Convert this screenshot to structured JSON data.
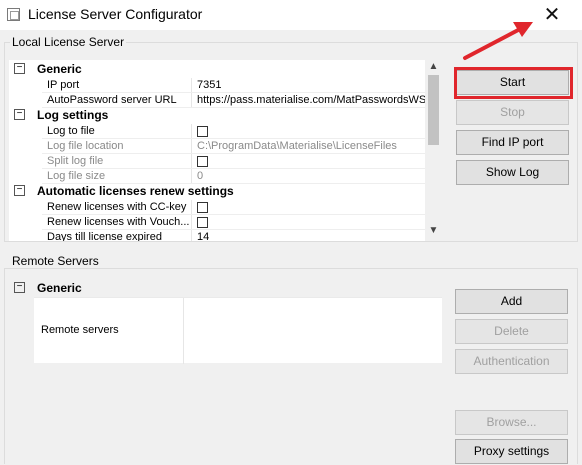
{
  "window": {
    "title": "License Server Configurator",
    "close_glyph": "✕",
    "app_icon": "window-icon"
  },
  "local_group": {
    "title": "Local License Server",
    "categories": [
      {
        "label": "Generic",
        "toggle": "−",
        "rows": [
          {
            "label": "IP port",
            "value": "7351",
            "type": "text",
            "dim": false
          },
          {
            "label": "AutoPassword server URL",
            "value": "https://pass.materialise.com/MatPasswordsWS/M",
            "type": "text",
            "dim": false
          }
        ]
      },
      {
        "label": "Log settings",
        "toggle": "−",
        "rows": [
          {
            "label": "Log to file",
            "value": "",
            "type": "checkbox",
            "dim": false
          },
          {
            "label": "Log file location",
            "value": "C:\\ProgramData\\Materialise\\LicenseFiles",
            "type": "text",
            "dim": true
          },
          {
            "label": "Split log file",
            "value": "",
            "type": "checkbox",
            "dim": true
          },
          {
            "label": "Log file size",
            "value": "0",
            "type": "text",
            "dim": true
          }
        ]
      },
      {
        "label": "Automatic licenses renew settings",
        "toggle": "−",
        "rows": [
          {
            "label": "Renew licenses with CC-key",
            "value": "",
            "type": "checkbox",
            "dim": false
          },
          {
            "label": "Renew licenses with Vouch...",
            "value": "",
            "type": "checkbox",
            "dim": false
          },
          {
            "label": "Days till license expired",
            "value": "14",
            "type": "text",
            "dim": false
          }
        ]
      }
    ],
    "scroll_up": "▲",
    "scroll_down": "▼",
    "buttons": {
      "start": "Start",
      "stop": "Stop",
      "find_ip_port": "Find IP port",
      "show_log": "Show Log"
    }
  },
  "remote_group": {
    "title": "Remote Servers",
    "category": {
      "label": "Generic",
      "toggle": "−"
    },
    "row_label": "Remote servers",
    "buttons": {
      "add": "Add",
      "delete": "Delete",
      "authentication": "Authentication",
      "browse": "Browse...",
      "proxy_settings": "Proxy settings"
    }
  },
  "colors": {
    "highlight": "#e0262c",
    "window_bg": "#f0f0f0"
  }
}
